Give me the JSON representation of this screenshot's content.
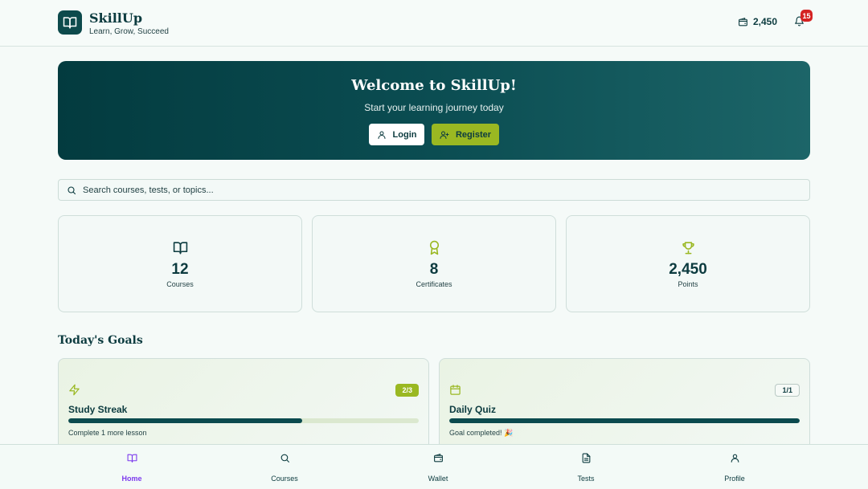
{
  "header": {
    "brand_name": "SkillUp",
    "tagline": "Learn, Grow, Succeed",
    "wallet_balance": "2,450",
    "notification_count": "15",
    "icons": [
      "book-open-icon",
      "wallet-icon",
      "bell-icon"
    ]
  },
  "hero": {
    "title": "Welcome to SkillUp!",
    "subtitle": "Start your learning journey today",
    "login_label": "Login",
    "register_label": "Register"
  },
  "search": {
    "placeholder": "Search courses, tests, or topics..."
  },
  "stats": [
    {
      "value": "12",
      "label": "Courses",
      "icon": "book-open-icon"
    },
    {
      "value": "8",
      "label": "Certificates",
      "icon": "award-icon"
    },
    {
      "value": "2,450",
      "label": "Points",
      "icon": "trophy-icon"
    }
  ],
  "goals": {
    "title": "Today's Goals",
    "items": [
      {
        "title": "Study Streak",
        "badge": "2/3",
        "progress": 0.667,
        "note": "Complete 1 more lesson",
        "icon": "lightning-icon"
      },
      {
        "title": "Daily Quiz",
        "badge": "1/1",
        "progress": 1.0,
        "note": "Goal completed! 🎉",
        "icon": "calendar-icon"
      }
    ]
  },
  "nav": {
    "items": [
      {
        "label": "Home",
        "icon": "book-open-icon",
        "active": true
      },
      {
        "label": "Courses",
        "icon": "search-icon",
        "active": false
      },
      {
        "label": "Wallet",
        "icon": "wallet-icon",
        "active": false
      },
      {
        "label": "Tests",
        "icon": "file-text-icon",
        "active": false
      },
      {
        "label": "Profile",
        "icon": "user-icon",
        "active": false
      }
    ]
  },
  "colors": {
    "primary": "#0c3b3f",
    "accent": "#9ab822",
    "active_nav": "#7c3aed",
    "badge_red": "#d42222"
  }
}
